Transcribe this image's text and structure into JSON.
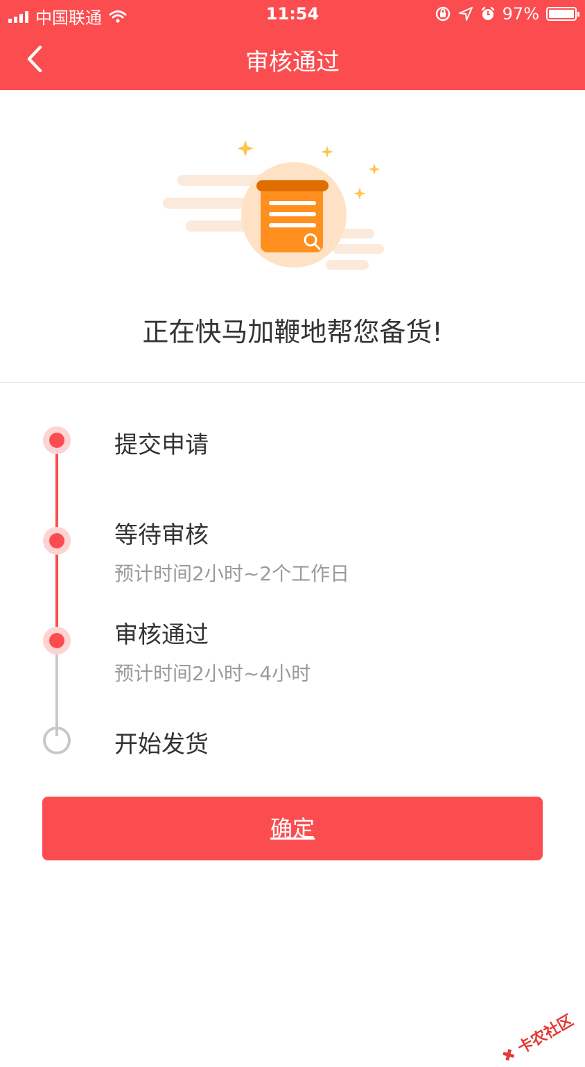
{
  "status_bar": {
    "carrier": "中国联通",
    "time": "11:54",
    "battery": "97%",
    "battery_level": 0.97
  },
  "nav": {
    "title": "审核通过"
  },
  "hero": {
    "message": "正在快马加鞭地帮您备货!"
  },
  "timeline": {
    "steps": [
      {
        "title": "提交申请",
        "subtitle": "",
        "state": "done"
      },
      {
        "title": "等待审核",
        "subtitle": "预计时间2小时~2个工作日",
        "state": "done"
      },
      {
        "title": "审核通过",
        "subtitle": "预计时间2小时~4小时",
        "state": "current"
      },
      {
        "title": "开始发货",
        "subtitle": "",
        "state": "todo"
      }
    ]
  },
  "actions": {
    "confirm_label": "确定"
  },
  "watermark": {
    "text": "卡农社区"
  },
  "colors": {
    "brand": "#fb4d4f",
    "inactive": "#c8c8c8",
    "text": "#333333",
    "subtext": "#9a9a9a"
  }
}
